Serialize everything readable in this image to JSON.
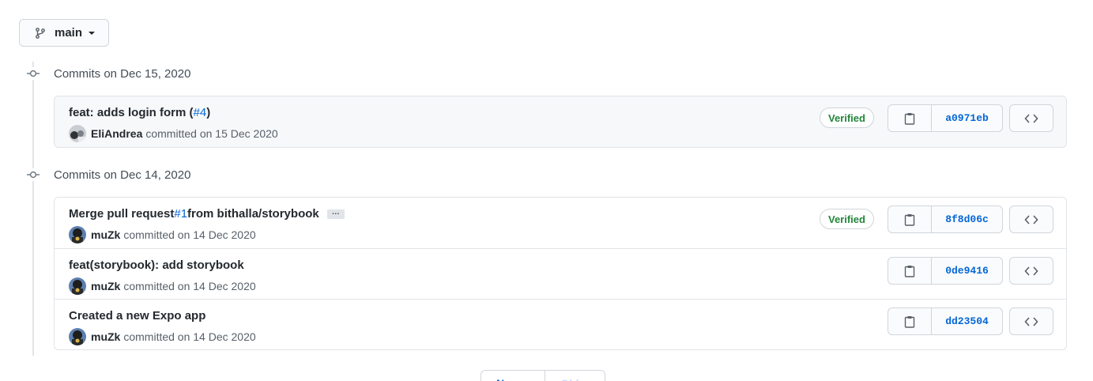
{
  "branch": {
    "name": "main"
  },
  "groups": [
    {
      "title": "Commits on Dec 15, 2020",
      "commits": [
        {
          "message": "feat: adds login form (",
          "pr": "#4",
          "message_tail": ")",
          "author": "EliAndrea",
          "meta": "committed on 15 Dec 2020",
          "verified": "Verified",
          "sha": "a0971eb"
        }
      ]
    },
    {
      "title": "Commits on Dec 14, 2020",
      "commits": [
        {
          "message": "Merge pull request ",
          "pr": "#1",
          "message_tail": " from bithalla/storybook",
          "ellipsis": "…",
          "author": "muZk",
          "meta": "committed on 14 Dec 2020",
          "verified": "Verified",
          "sha": "8f8d06c"
        },
        {
          "message": "feat(storybook): add storybook",
          "author": "muZk",
          "meta": "committed on 14 Dec 2020",
          "sha": "0de9416"
        },
        {
          "message": "Created a new Expo app",
          "author": "muZk",
          "meta": "committed on 14 Dec 2020",
          "sha": "dd23504"
        }
      ]
    }
  ],
  "pagination": {
    "newer": "Newer",
    "older": "Older"
  },
  "colors": {
    "link": "#0366d6",
    "verified": "#22863a",
    "border": "#e1e4e8"
  }
}
